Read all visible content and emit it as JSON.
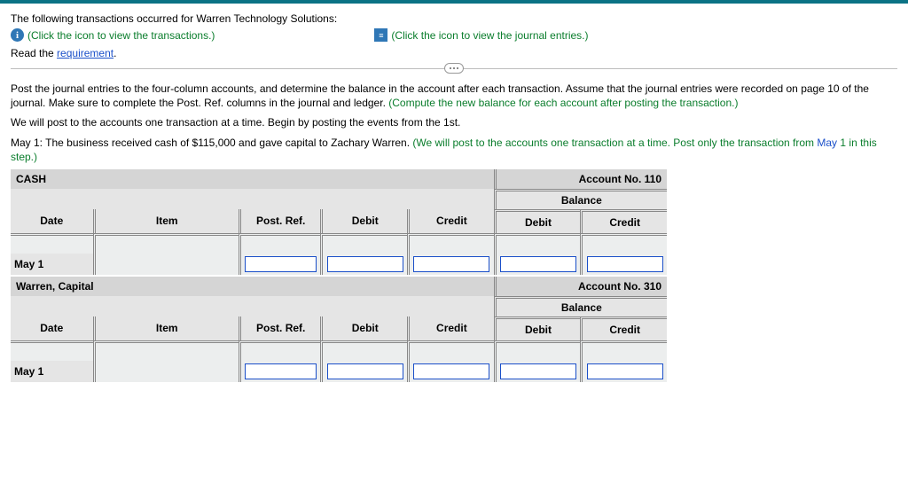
{
  "intro": "The following transactions occurred for Warren Technology Solutions:",
  "links": {
    "transactions": "(Click the icon to view the transactions.)",
    "journal": "(Click the icon to view the journal entries.)",
    "read": "Read the",
    "requirement": "requirement"
  },
  "body": {
    "p1a": "Post the journal entries to the four-column accounts, and determine the balance in the account after each transaction. Assume that the journal entries were recorded on page 10 of the journal. Make sure to complete the Post. Ref. columns in the journal and ledger.",
    "p1b": "(Compute the new balance for each account after posting the transaction.)",
    "p2": "We will post to the accounts one transaction at a time. Begin by posting the events from the 1st.",
    "p3a": "May 1: The business received cash of $115,000 and gave capital to Zachary Warren.",
    "p3b": "(We will post to the accounts one transaction at a time. Post only the transaction from",
    "p3c": "May",
    "p3d": "1 in this step.)"
  },
  "columns": {
    "date": "Date",
    "item": "Item",
    "postref": "Post. Ref.",
    "debit": "Debit",
    "credit": "Credit",
    "balance": "Balance"
  },
  "accounts": [
    {
      "name": "CASH",
      "acctno": "Account No. 110",
      "date": "May 1"
    },
    {
      "name": "Warren, Capital",
      "acctno": "Account No. 310",
      "date": "May 1"
    }
  ]
}
